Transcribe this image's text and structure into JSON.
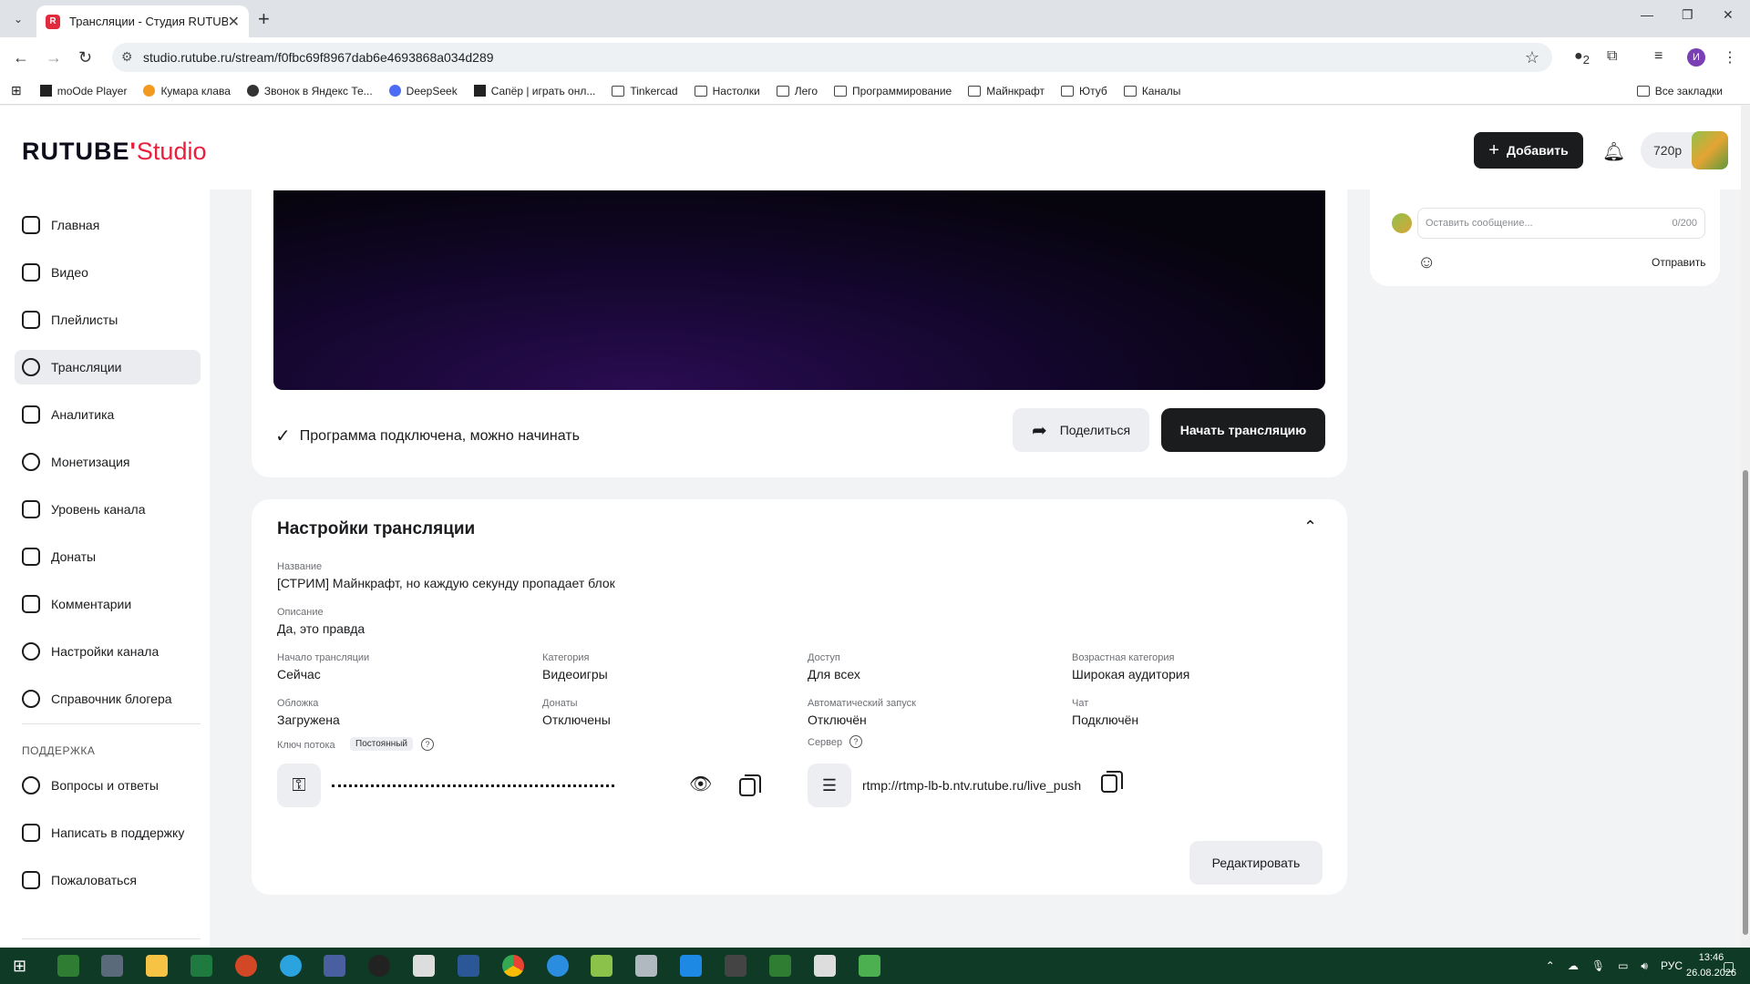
{
  "browser": {
    "tab_title": "Трансляции - Студия RUTUBE",
    "tab_favicon": "R",
    "url": "studio.rutube.ru/stream/f0fbc69f8967dab6e4693868a034d289",
    "profile_letter": "И",
    "ext_badge": "2",
    "bookmarks": [
      "moOde Player",
      "Кумара клава",
      "Звонок в Яндекс Те...",
      "DeepSeek",
      "Сапёр | играть онл...",
      "Tinkercad",
      "Настолки",
      "Лего",
      "Программирование",
      "Майнкрафт",
      "Ютуб",
      "Каналы"
    ],
    "all_bookmarks": "Все закладки"
  },
  "header": {
    "logo_main": "RUTUBE",
    "logo_sub": "Studio",
    "add_label": "Добавить",
    "quality": "720p"
  },
  "sidebar": {
    "items": [
      "Главная",
      "Видео",
      "Плейлисты",
      "Трансляции",
      "Аналитика",
      "Монетизация",
      "Уровень канала",
      "Донаты",
      "Комментарии",
      "Настройки канала",
      "Справочник блогера"
    ],
    "support_label": "ПОДДЕРЖКА",
    "support_items": [
      "Вопросы и ответы",
      "Написать в поддержку",
      "Пожаловаться"
    ]
  },
  "stream": {
    "status_text": "Программа подключена, можно начинать",
    "share_label": "Поделиться",
    "start_label": "Начать трансляцию"
  },
  "settings": {
    "title": "Настройки трансляции",
    "name_label": "Название",
    "name_value": "[СТРИМ] Майнкрафт, но каждую секунду пропадает блок",
    "desc_label": "Описание",
    "desc_value": "Да, это правда",
    "start_label": "Начало трансляции",
    "start_value": "Сейчас",
    "category_label": "Категория",
    "category_value": "Видеоигры",
    "access_label": "Доступ",
    "access_value": "Для всех",
    "age_label": "Возрастная категория",
    "age_value": "Широкая аудитория",
    "cover_label": "Обложка",
    "cover_value": "Загружена",
    "donations_label": "Донаты",
    "donations_value": "Отключены",
    "autostart_label": "Автоматический запуск",
    "autostart_value": "Отключён",
    "chat_label": "Чат",
    "chat_value": "Подключён",
    "key_label": "Ключ потока",
    "key_badge": "Постоянный",
    "server_label": "Сервер",
    "server_value": "rtmp://rtmp-lb-b.ntv.rutube.ru/live_push",
    "edit_label": "Редактировать"
  },
  "chat": {
    "placeholder": "Оставить сообщение...",
    "counter": "0/200",
    "send_label": "Отправить"
  },
  "taskbar": {
    "lang": "РУС",
    "time": "13:46",
    "date": "26.08.2026"
  }
}
